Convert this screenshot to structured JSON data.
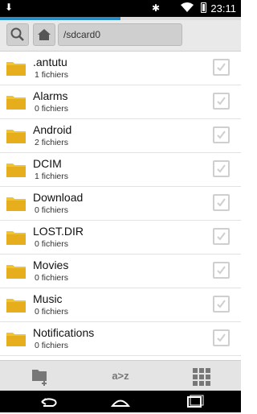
{
  "status_bar": {
    "time": "23:11",
    "icons": [
      "download-icon",
      "bluetooth-icon",
      "wifi-icon",
      "battery-icon"
    ]
  },
  "progress": {
    "fraction": 0.5
  },
  "toolbar": {
    "icons": [
      "search-icon",
      "home-icon"
    ],
    "path": "/sdcard0"
  },
  "files": [
    {
      "name": ".antutu",
      "info": "1 fichiers"
    },
    {
      "name": "Alarms",
      "info": "0 fichiers"
    },
    {
      "name": "Android",
      "info": "2 fichiers"
    },
    {
      "name": "DCIM",
      "info": "1 fichiers"
    },
    {
      "name": "Download",
      "info": "0 fichiers"
    },
    {
      "name": "LOST.DIR",
      "info": "0 fichiers"
    },
    {
      "name": "Movies",
      "info": "0 fichiers"
    },
    {
      "name": "Music",
      "info": "0 fichiers"
    },
    {
      "name": "Notifications",
      "info": "0 fichiers"
    }
  ],
  "bottom_bar": {
    "icons": [
      "new-folder-icon",
      "sort-az-icon",
      "grid-view-icon"
    ],
    "sort_label": "a>z"
  },
  "nav_bar": {
    "icons": [
      "back-icon",
      "home-icon",
      "recents-icon"
    ]
  },
  "colors": {
    "folder": "#f2c230",
    "progress": "#2b8cc4",
    "toolbar_bg": "#e9e9e9"
  }
}
